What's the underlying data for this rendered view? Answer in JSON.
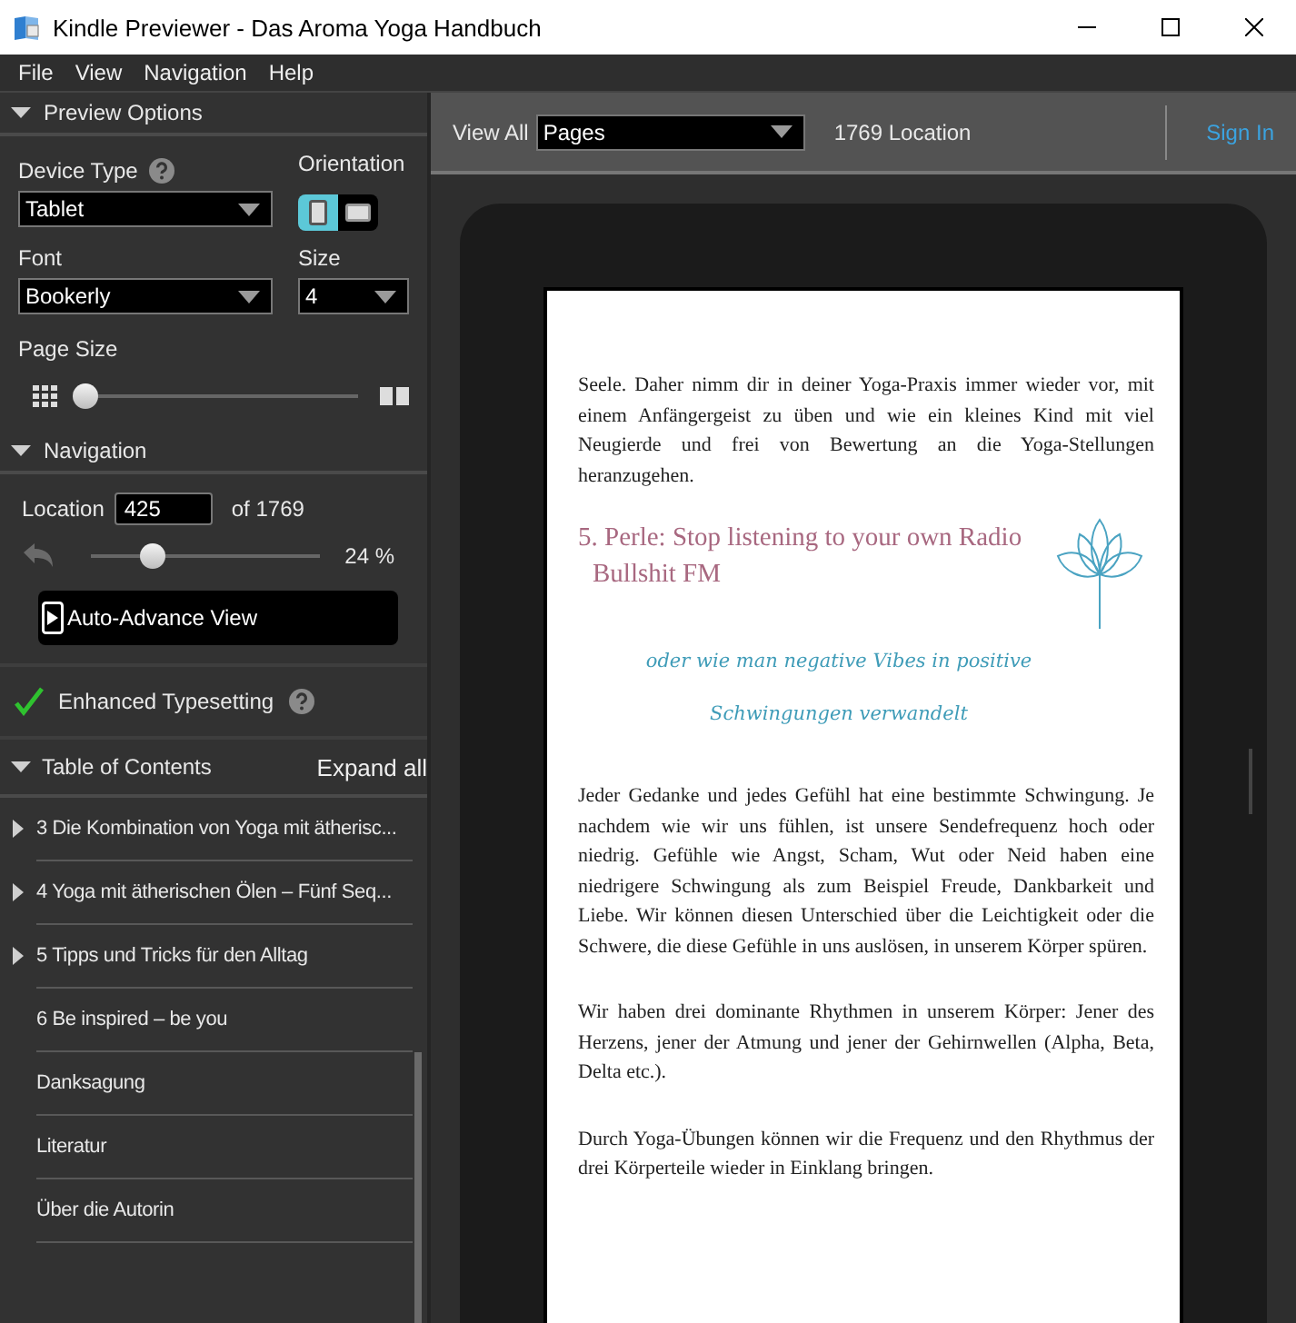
{
  "window": {
    "title": "Kindle Previewer - Das Aroma Yoga Handbuch"
  },
  "menu": [
    "File",
    "View",
    "Navigation",
    "Help"
  ],
  "preview_options": {
    "title": "Preview Options",
    "expanded": true,
    "device_type": {
      "label": "Device Type",
      "value": "Tablet"
    },
    "orientation": {
      "label": "Orientation",
      "options": [
        {
          "kind": "portrait",
          "selected": true
        },
        {
          "kind": "landscape",
          "selected": false
        }
      ]
    },
    "font": {
      "label": "Font",
      "value": "Bookerly"
    },
    "size": {
      "label": "Size",
      "value": "4"
    },
    "page_size": {
      "label": "Page Size",
      "level": 0.02
    }
  },
  "navigation": {
    "title": "Navigation",
    "expanded": true,
    "location_label": "Location",
    "location": "425",
    "of_total": "of 1769",
    "level": 0.27,
    "percent": "24 %",
    "auto_advance": "Auto-Advance View"
  },
  "enhanced_typesetting": {
    "label": "Enhanced Typesetting",
    "checked": true
  },
  "toc": {
    "title": "Table of Contents",
    "expanded": true,
    "expand_all": "Expand all",
    "items": [
      {
        "label": "3 Die Kombination von Yoga mit ätherisc...",
        "expandable": true
      },
      {
        "label": "4 Yoga mit ätherischen Ölen – Fünf Seq...",
        "expandable": true
      },
      {
        "label": "5 Tipps und Tricks für den Alltag",
        "expandable": true
      },
      {
        "label": "6 Be inspired – be you",
        "expandable": false
      },
      {
        "label": "Danksagung",
        "expandable": false
      },
      {
        "label": "Literatur",
        "expandable": false
      },
      {
        "label": "Über die Autorin",
        "expandable": false
      }
    ]
  },
  "toolbar": {
    "view_all": "View All",
    "view_mode": "Pages",
    "location_count": "1769 Location",
    "sign_in": "Sign In"
  },
  "book_page": {
    "blocks": [
      {
        "kind": "paragraph",
        "text": "Seele. Daher nimm dir in deiner Yoga-Praxis immer wieder vor, mit einem Anfängergeist zu üben und wie ein kleines Kind mit viel Neugierde und frei von Bewertung an die Yoga-Stellungen heranzugehen."
      },
      {
        "kind": "heading",
        "text": "5. Perle: Stop listening to your own Radio Bullshit FM"
      },
      {
        "kind": "subtitle",
        "text": "oder wie man negative Vibes in positive Schwingungen verwandelt"
      },
      {
        "kind": "paragraph",
        "text": "Jeder Gedanke und jedes Gefühl hat eine bestimmte Schwingung. Je nachdem wie wir uns fühlen, ist unsere Sendefrequenz hoch oder niedrig. Gefühle wie Angst, Scham, Wut oder Neid haben eine niedrigere Schwingung als zum Beispiel Freude, Dankbarkeit und Liebe. Wir können diesen Unterschied über die Leichtigkeit oder die Schwere, die diese Gefühle in uns auslösen, in unserem Körper spüren."
      },
      {
        "kind": "paragraph",
        "text": "Wir haben drei dominante Rhythmen in unserem Körper: Jener des Herzens, jener der Atmung und jener der Gehirnwellen (Alpha, Beta, Delta etc.)."
      },
      {
        "kind": "paragraph",
        "text": "Durch Yoga-Übungen können wir die Frequenz und den Rhythmus der drei Körperteile wieder in Einklang bringen."
      }
    ]
  }
}
